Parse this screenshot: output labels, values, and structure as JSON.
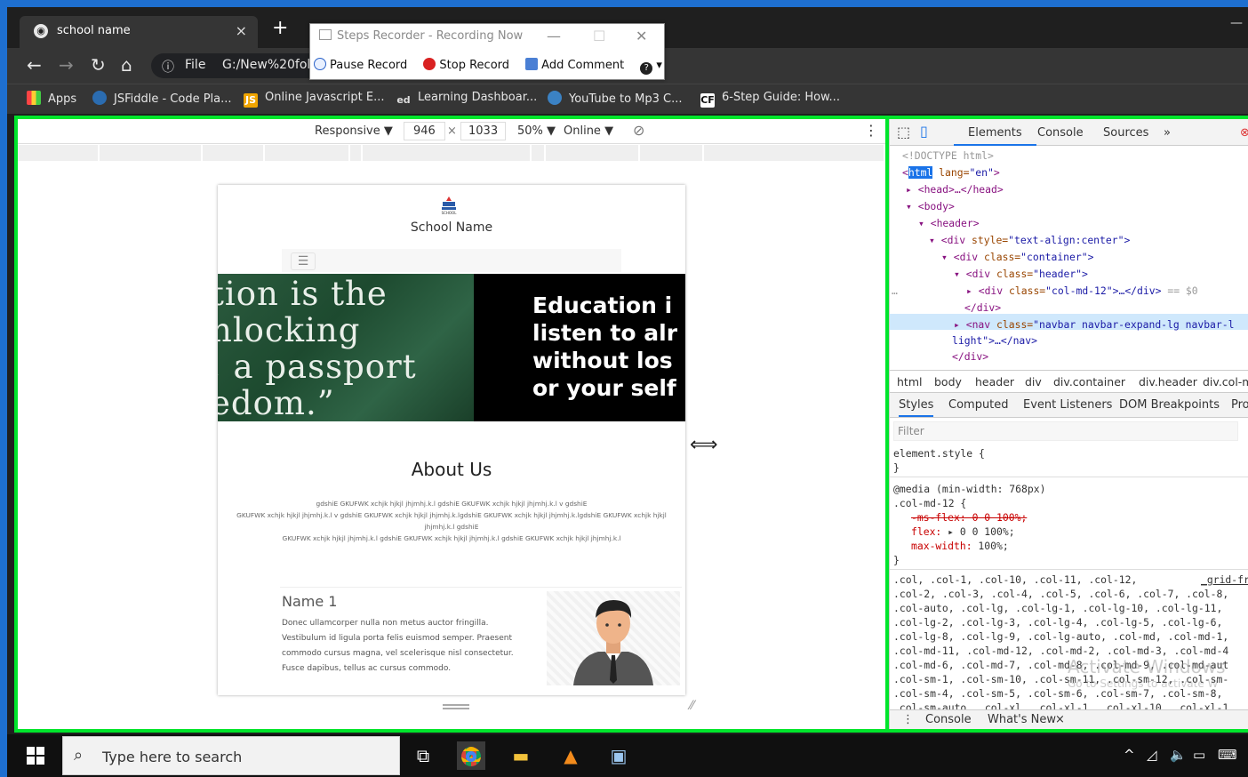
{
  "browser": {
    "tab_title": "school name",
    "tab_close": "×",
    "new_tab": "+",
    "address_info": "ⓘ",
    "address_scheme": "File",
    "address_url": "G:/New%20fol",
    "bookmarks": [
      {
        "label": "Apps"
      },
      {
        "label": "JSFiddle - Code Pla..."
      },
      {
        "label": "Online Javascript E..."
      },
      {
        "label": "Learning Dashboar..."
      },
      {
        "label": "YouTube to Mp3 C..."
      },
      {
        "label": "6-Step Guide: How..."
      }
    ],
    "bookmark_icon_text": {
      "js": "JS",
      "ed": "ed",
      "cf": "CF"
    }
  },
  "steps_recorder": {
    "title": "Steps Recorder - Recording Now",
    "pause": "Pause Record",
    "stop": "Stop Record",
    "add_comment": "Add Comment",
    "help": "?"
  },
  "device_toolbar": {
    "mode": "Responsive ▼",
    "width": "946",
    "times": "×",
    "height": "1033",
    "zoom": "50% ▼",
    "network": "Online ▼",
    "more": "⋮"
  },
  "page": {
    "school_name": "School Name",
    "logo_text": "SCHOOL",
    "banner_left_lines": [
      "tion is the",
      "nlocking",
      ", a passport",
      "edom.”"
    ],
    "banner_right_lines": [
      "Education i",
      "listen to alr",
      "without los",
      "or your self"
    ],
    "about_title": "About Us",
    "about_lines": [
      "gdshiE GKUFWK xchjk hjkjl jhjmhj.k.l gdshiE GKUFWK xchjk hjkjl jhjmhj.k.l v gdshiE",
      "GKUFWK xchjk hjkjl jhjmhj.k.l v gdshiE GKUFWK xchjk hjkjl jhjmhj.k.lgdshiE GKUFWK xchjk hjkjl jhjmhj.k.lgdshiE GKUFWK xchjk hjkjl",
      "jhjmhj.k.l gdshiE",
      "GKUFWK xchjk hjkjl jhjmhj.k.l gdshiE GKUFWK xchjk hjkjl jhjmhj.k.l gdshiE GKUFWK xchjk hjkjl jhjmhj.k.l"
    ],
    "person_name": "Name 1",
    "person_desc": "Donec ullamcorper nulla non metus auctor fringilla. Vestibulum id ligula porta felis euismod semper. Praesent commodo cursus magna, vel scelerisque nisl consectetur. Fusce dapibus, tellus ac cursus commodo."
  },
  "devtools": {
    "tabs": [
      "Elements",
      "Console",
      "Sources",
      "»"
    ],
    "dom": {
      "doctype": "<!DOCTYPE html>",
      "html_tag": "html",
      "html_attr": " lang=",
      "html_val": "\"en\"",
      "head": "<head>…</head>",
      "body": "<body>",
      "header": "<header>",
      "div_center": "<div",
      "div_center_attr": " style=",
      "div_center_val": "\"text-align:center\">",
      "div_container": "<div",
      "div_container_attr": " class=",
      "div_container_val": "\"container\">",
      "div_header": "<div",
      "div_header_attr": " class=",
      "div_header_val": "\"header\">",
      "div_col": "<div",
      "div_col_attr": " class=",
      "div_col_val": "\"col-md-12\">…</div>",
      "div_col_suffix": " == $0",
      "close_div": "</div>",
      "nav": "<nav",
      "nav_attr": " class=",
      "nav_val": "\"navbar navbar-expand-lg navbar-l",
      "nav_cont": "light\">…</nav>",
      "close_div2": "</div>",
      "dots": "…"
    },
    "crumbs": [
      "html",
      "body",
      "header",
      "div",
      "div.container",
      "div.header",
      "div.col-m"
    ],
    "style_tabs": [
      "Styles",
      "Computed",
      "Event Listeners",
      "DOM Breakpoints",
      "Pro"
    ],
    "filter_placeholder": "Filter",
    "styles": {
      "element_style": "element.style {",
      "close": "}",
      "media": "@media (min-width: 768px)",
      "selector": ".col-md-12 {",
      "ms_flex": "-ms-flex: 0 0 100%;",
      "flex_prop": "flex:",
      "flex_val": " ▸ 0 0 100%;",
      "maxw_prop": "max-width:",
      "maxw_val": " 100%;",
      "close2": "}",
      "grid_link": "_grid-fr",
      "col_lines": [
        ".col, .col-1, .col-10, .col-11, .col-12,",
        ".col-2, .col-3, .col-4, .col-5, .col-6, .col-7, .col-8,",
        ".col-auto, .col-lg, .col-lg-1, .col-lg-10, .col-lg-11,",
        ".col-lg-2, .col-lg-3, .col-lg-4, .col-lg-5, .col-lg-6,",
        ".col-lg-8, .col-lg-9, .col-lg-auto, .col-md, .col-md-1,",
        ".col-md-11, .col-md-12, .col-md-2, .col-md-3, .col-md-4",
        ".col-md-6, .col-md-7, .col-md-8, .col-md-9, .col-md-aut",
        ".col-sm-1, .col-sm-10, .col-sm-11, .col-sm-12, .col-sm-",
        ".col-sm-4, .col-sm-5, .col-sm-6, .col-sm-7, .col-sm-8,",
        ".col-sm-auto, .col-xl, .col-xl-1, .col-xl-10, .col-xl-1"
      ]
    },
    "drawer": [
      "⋮",
      "Console",
      "What's New",
      "×"
    ],
    "watermark": "Activate Windows",
    "watermark_sub": "Go to Settings to activate W"
  },
  "taskbar": {
    "search_placeholder": "Type here to search"
  },
  "colors": {
    "accent_border": "#1e6fd0",
    "highlight_green": "#00e52c"
  }
}
